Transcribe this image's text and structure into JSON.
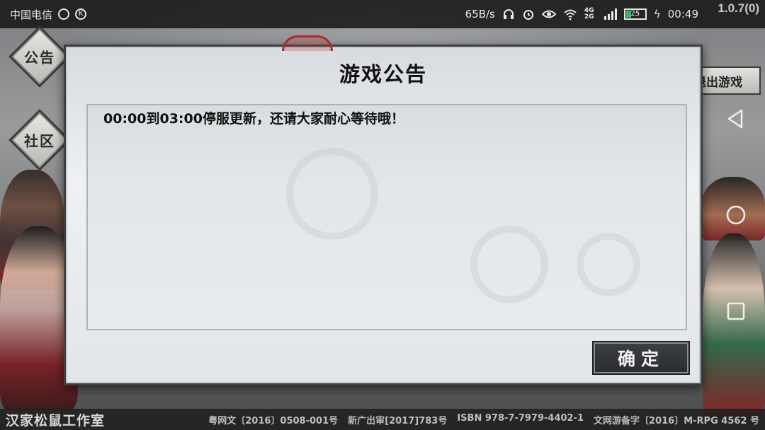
{
  "status_bar": {
    "carrier": "中国电信",
    "net_speed": "65B/s",
    "network_type": "4G 2G",
    "battery_level": "25",
    "time": "00:49",
    "icons": [
      "alarm-clock-icon",
      "k-app-icon",
      "headphones-icon",
      "alarm-icon",
      "eye-icon",
      "wifi-icon",
      "signal-icon",
      "battery-icon",
      "charging-icon"
    ]
  },
  "version": "1.0.7(0)",
  "side_menu": {
    "announcement_label": "公告",
    "community_label": "社区"
  },
  "exit_button": {
    "label": "退出游戏"
  },
  "dialog": {
    "title": "游戏公告",
    "message": "00:00到03:00停服更新，还请大家耐心等待哦！",
    "confirm_label": "确定"
  },
  "footer": {
    "studio": "汉家松鼠工作室",
    "licenses": [
      "粤网文〔2016〕0508-001号",
      "新广出审[2017]783号",
      "ISBN 978-7-7979-4402-1",
      "文网游备字〔2016〕M-RPG 4562 号"
    ]
  },
  "colors": {
    "dialog_border": "#3d3f42",
    "button_bg": "#2a2c30",
    "seal_red": "#b2272b"
  }
}
